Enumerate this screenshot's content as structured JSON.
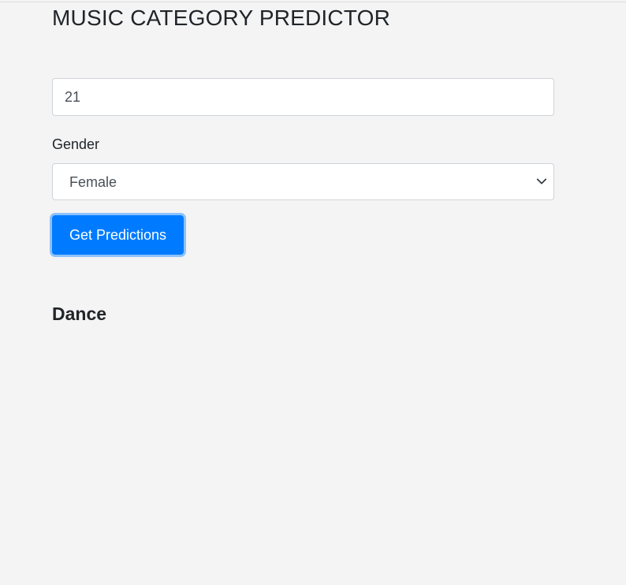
{
  "page": {
    "title": "MUSIC CATEGORY PREDICTOR"
  },
  "form": {
    "age_value": "21",
    "gender_label": "Gender",
    "gender_selected": "Female",
    "submit_label": "Get Predictions"
  },
  "result": {
    "prediction": "Dance"
  },
  "icons": {
    "select_arrow": "chevron-down-icon"
  },
  "colors": {
    "background": "#f4f4f4",
    "primary_button": "#007bff",
    "text": "#212529"
  }
}
